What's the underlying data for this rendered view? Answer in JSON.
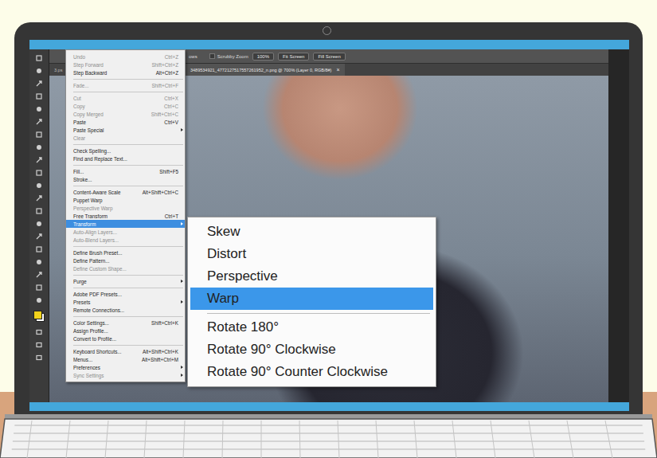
{
  "options_bar": {
    "partial_label": "ows",
    "checkbox": {
      "label": "Scrubby Zoom",
      "checked": false
    },
    "buttons": [
      "100%",
      "Fit Screen",
      "Fill Screen"
    ]
  },
  "tabs": [
    {
      "label": "3.ps",
      "selected": false,
      "close": ""
    },
    {
      "label": "3489534921_4772127517557261952_n.png @ 700% (Layer 0, RGB/8#)",
      "selected": true,
      "close": "×"
    }
  ],
  "edit_menu": {
    "groups": [
      [
        {
          "label": "Undo",
          "shortcut": "Ctrl+Z",
          "disabled": true,
          "has_submenu": false,
          "selected": false
        },
        {
          "label": "Step Forward",
          "shortcut": "Shift+Ctrl+Z",
          "disabled": true,
          "has_submenu": false,
          "selected": false
        },
        {
          "label": "Step Backward",
          "shortcut": "Alt+Ctrl+Z",
          "disabled": false,
          "has_submenu": false,
          "selected": false
        }
      ],
      [
        {
          "label": "Fade...",
          "shortcut": "Shift+Ctrl+F",
          "disabled": true,
          "has_submenu": false,
          "selected": false
        }
      ],
      [
        {
          "label": "Cut",
          "shortcut": "Ctrl+X",
          "disabled": true,
          "has_submenu": false,
          "selected": false
        },
        {
          "label": "Copy",
          "shortcut": "Ctrl+C",
          "disabled": true,
          "has_submenu": false,
          "selected": false
        },
        {
          "label": "Copy Merged",
          "shortcut": "Shift+Ctrl+C",
          "disabled": true,
          "has_submenu": false,
          "selected": false
        },
        {
          "label": "Paste",
          "shortcut": "Ctrl+V",
          "disabled": false,
          "has_submenu": false,
          "selected": false
        },
        {
          "label": "Paste Special",
          "shortcut": "",
          "disabled": false,
          "has_submenu": true,
          "selected": false
        },
        {
          "label": "Clear",
          "shortcut": "",
          "disabled": true,
          "has_submenu": false,
          "selected": false
        }
      ],
      [
        {
          "label": "Check Spelling...",
          "shortcut": "",
          "disabled": false,
          "has_submenu": false,
          "selected": false
        },
        {
          "label": "Find and Replace Text...",
          "shortcut": "",
          "disabled": false,
          "has_submenu": false,
          "selected": false
        }
      ],
      [
        {
          "label": "Fill...",
          "shortcut": "Shift+F5",
          "disabled": false,
          "has_submenu": false,
          "selected": false
        },
        {
          "label": "Stroke...",
          "shortcut": "",
          "disabled": false,
          "has_submenu": false,
          "selected": false
        }
      ],
      [
        {
          "label": "Content-Aware Scale",
          "shortcut": "Alt+Shift+Ctrl+C",
          "disabled": false,
          "has_submenu": false,
          "selected": false
        },
        {
          "label": "Puppet Warp",
          "shortcut": "",
          "disabled": false,
          "has_submenu": false,
          "selected": false
        },
        {
          "label": "Perspective Warp",
          "shortcut": "",
          "disabled": true,
          "has_submenu": false,
          "selected": false
        },
        {
          "label": "Free Transform",
          "shortcut": "Ctrl+T",
          "disabled": false,
          "has_submenu": false,
          "selected": false
        },
        {
          "label": "Transform",
          "shortcut": "",
          "disabled": false,
          "has_submenu": true,
          "selected": true
        },
        {
          "label": "Auto-Align Layers...",
          "shortcut": "",
          "disabled": true,
          "has_submenu": false,
          "selected": false
        },
        {
          "label": "Auto-Blend Layers...",
          "shortcut": "",
          "disabled": true,
          "has_submenu": false,
          "selected": false
        }
      ],
      [
        {
          "label": "Define Brush Preset...",
          "shortcut": "",
          "disabled": false,
          "has_submenu": false,
          "selected": false
        },
        {
          "label": "Define Pattern...",
          "shortcut": "",
          "disabled": false,
          "has_submenu": false,
          "selected": false
        },
        {
          "label": "Define Custom Shape...",
          "shortcut": "",
          "disabled": true,
          "has_submenu": false,
          "selected": false
        }
      ],
      [
        {
          "label": "Purge",
          "shortcut": "",
          "disabled": false,
          "has_submenu": true,
          "selected": false
        }
      ],
      [
        {
          "label": "Adobe PDF Presets...",
          "shortcut": "",
          "disabled": false,
          "has_submenu": false,
          "selected": false
        },
        {
          "label": "Presets",
          "shortcut": "",
          "disabled": false,
          "has_submenu": true,
          "selected": false
        },
        {
          "label": "Remote Connections...",
          "shortcut": "",
          "disabled": false,
          "has_submenu": false,
          "selected": false
        }
      ],
      [
        {
          "label": "Color Settings...",
          "shortcut": "Shift+Ctrl+K",
          "disabled": false,
          "has_submenu": false,
          "selected": false
        },
        {
          "label": "Assign Profile...",
          "shortcut": "",
          "disabled": false,
          "has_submenu": false,
          "selected": false
        },
        {
          "label": "Convert to Profile...",
          "shortcut": "",
          "disabled": false,
          "has_submenu": false,
          "selected": false
        }
      ],
      [
        {
          "label": "Keyboard Shortcuts...",
          "shortcut": "Alt+Shift+Ctrl+K",
          "disabled": false,
          "has_submenu": false,
          "selected": false
        },
        {
          "label": "Menus...",
          "shortcut": "Alt+Shift+Ctrl+M",
          "disabled": false,
          "has_submenu": false,
          "selected": false
        },
        {
          "label": "Preferences",
          "shortcut": "",
          "disabled": false,
          "has_submenu": true,
          "selected": false
        },
        {
          "label": "Sync Settings",
          "shortcut": "",
          "disabled": true,
          "has_submenu": true,
          "selected": false
        }
      ]
    ]
  },
  "transform_submenu": {
    "groups": [
      [
        {
          "label": "Skew",
          "selected": false
        },
        {
          "label": "Distort",
          "selected": false
        },
        {
          "label": "Perspective",
          "selected": false
        },
        {
          "label": "Warp",
          "selected": true
        }
      ],
      [
        {
          "label": "Rotate 180°",
          "selected": false
        },
        {
          "label": "Rotate 90° Clockwise",
          "selected": false
        },
        {
          "label": "Rotate 90° Counter Clockwise",
          "selected": false
        }
      ]
    ]
  }
}
